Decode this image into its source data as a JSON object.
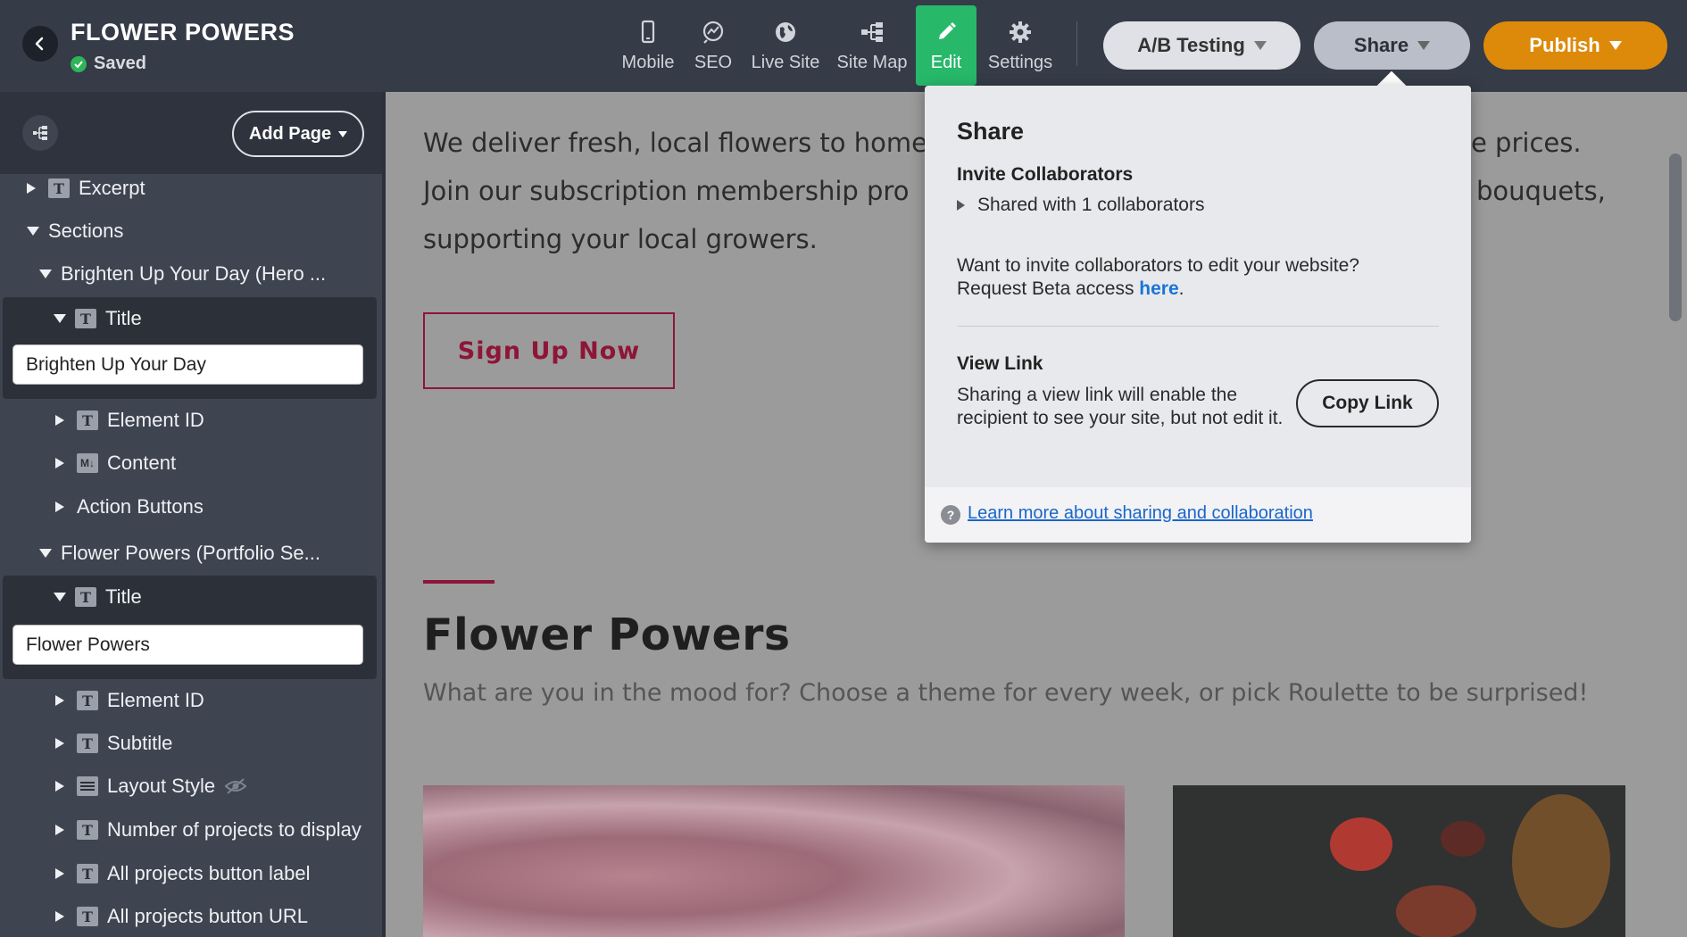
{
  "header": {
    "site_title": "FLOWER POWERS",
    "status": "Saved",
    "tools": [
      {
        "label": "Mobile",
        "icon": "mobile-icon"
      },
      {
        "label": "SEO",
        "icon": "seo-icon"
      },
      {
        "label": "Live Site",
        "icon": "globe-icon"
      },
      {
        "label": "Site Map",
        "icon": "sitemap-icon"
      },
      {
        "label": "Edit",
        "icon": "pencil-icon",
        "active": true
      },
      {
        "label": "Settings",
        "icon": "gear-icon"
      }
    ],
    "ab_testing_label": "A/B Testing",
    "share_label": "Share",
    "publish_label": "Publish"
  },
  "sidebar": {
    "add_page_label": "Add Page",
    "items": [
      {
        "label": "Excerpt"
      },
      {
        "label": "Sections"
      },
      {
        "label": "Brighten Up Your Day (Hero ..."
      },
      {
        "label": "Title"
      },
      {
        "label": "Element ID"
      },
      {
        "label": "Content",
        "icon_text": "M↓"
      },
      {
        "label": "Action Buttons"
      },
      {
        "label": "Flower Powers (Portfolio Se..."
      },
      {
        "label": "Title"
      },
      {
        "label": "Element ID"
      },
      {
        "label": "Subtitle"
      },
      {
        "label": "Layout Style"
      },
      {
        "label": "Number of projects to display"
      },
      {
        "label": "All projects button label"
      },
      {
        "label": "All projects button URL"
      }
    ],
    "fields": [
      {
        "value": "Brighten Up Your Day"
      },
      {
        "value": "Flower Powers"
      }
    ]
  },
  "canvas": {
    "hero_lines": [
      "We deliver fresh, local flowers to home",
      "Join our subscription membership pro",
      "supporting your local growers."
    ],
    "hero_right_fragments": [
      "e prices.",
      "bouquets,"
    ],
    "signup_label": "Sign Up Now",
    "section_title": "Flower Powers",
    "section_subtitle": "What are you in the mood for? Choose a theme for every week, or pick Roulette to be surprised!"
  },
  "share_popover": {
    "title": "Share",
    "invite_heading": "Invite Collaborators",
    "shared_with": "Shared with 1 collaborators",
    "invite_text_line1": "Want to invite collaborators to edit your website?",
    "invite_text_line2_prefix": "Request Beta access ",
    "invite_link": "here",
    "invite_text_suffix": ".",
    "view_link_heading": "View Link",
    "view_link_text": "Sharing a view link will enable the recipient to see your site, but not edit it.",
    "copy_link_label": "Copy Link",
    "learn_more_link": "Learn more about sharing and collaboration"
  },
  "colors": {
    "topbar": "#353b47",
    "edit_active": "#27b86a",
    "publish": "#dd8a0a",
    "accent": "#8e1538",
    "link": "#1a74d6"
  }
}
